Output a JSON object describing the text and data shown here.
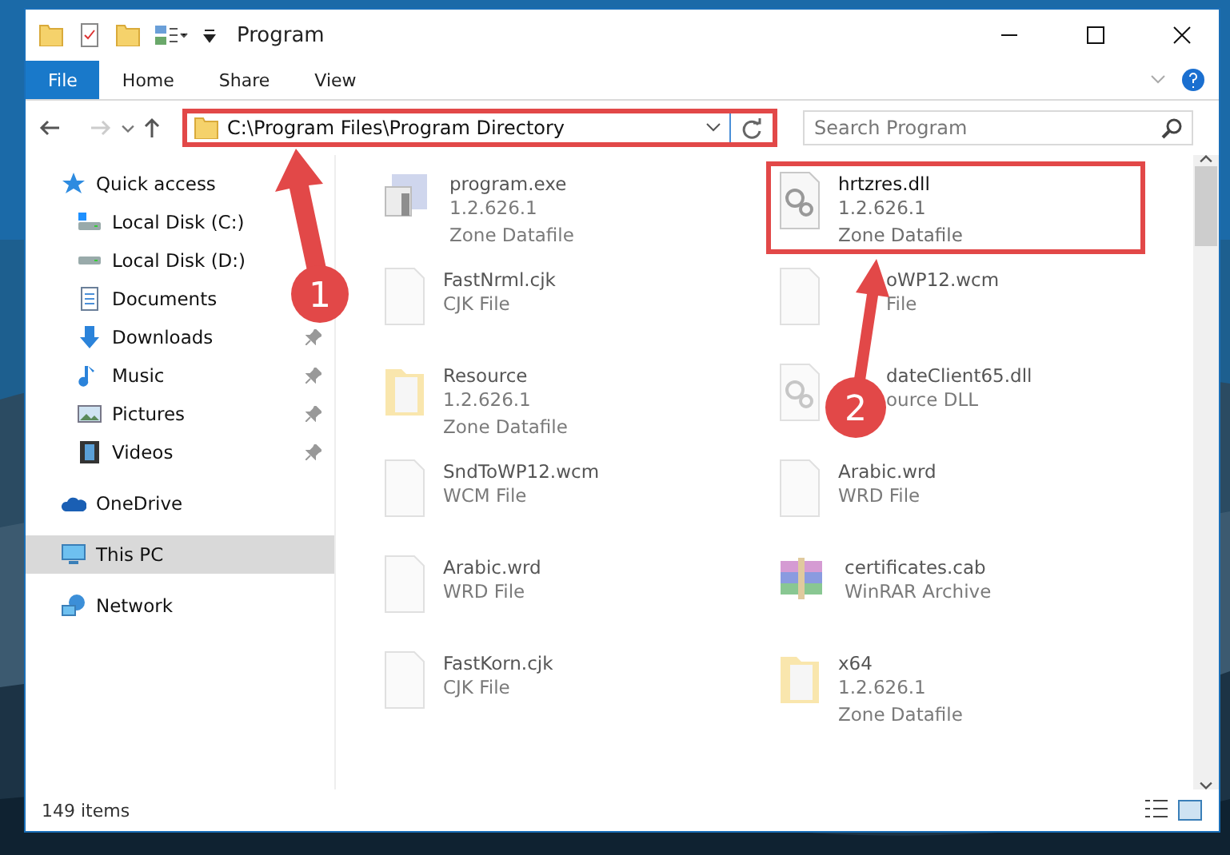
{
  "window": {
    "title": "Program"
  },
  "ribbon_tabs": [
    {
      "label": "File",
      "selected": true
    },
    {
      "label": "Home",
      "selected": false
    },
    {
      "label": "Share",
      "selected": false
    },
    {
      "label": "View",
      "selected": false
    }
  ],
  "address_bar": {
    "path": "C:\\Program Files\\Program Directory",
    "highlighted": true
  },
  "search": {
    "placeholder": "Search Program"
  },
  "sidebar": {
    "items": [
      {
        "label": "Quick access",
        "kind": "star",
        "pinned": false,
        "selected": false,
        "children": [
          {
            "label": "Local Disk (C:)",
            "kind": "disk-c",
            "pinned": false,
            "selected": false
          },
          {
            "label": "Local Disk (D:)",
            "kind": "disk",
            "pinned": false,
            "selected": false
          },
          {
            "label": "Documents",
            "kind": "documents",
            "pinned": false,
            "selected": false
          },
          {
            "label": "Downloads",
            "kind": "downloads",
            "pinned": true,
            "selected": false
          },
          {
            "label": "Music",
            "kind": "music",
            "pinned": true,
            "selected": false
          },
          {
            "label": "Pictures",
            "kind": "pictures",
            "pinned": true,
            "selected": false
          },
          {
            "label": "Videos",
            "kind": "videos",
            "pinned": true,
            "selected": false
          }
        ]
      },
      {
        "label": "OneDrive",
        "kind": "cloud",
        "pinned": false,
        "selected": false
      },
      {
        "label": "This PC",
        "kind": "pc",
        "pinned": false,
        "selected": true
      },
      {
        "label": "Network",
        "kind": "network",
        "pinned": false,
        "selected": false
      }
    ]
  },
  "files": [
    {
      "name": "program.exe",
      "lines": [
        "1.2.626.1",
        "Zone Datafile"
      ],
      "kind": "exe",
      "blurred": true,
      "highlighted": false,
      "partly_covered": false
    },
    {
      "name": "hrtzres.dll",
      "lines": [
        "1.2.626.1",
        "Zone Datafile"
      ],
      "kind": "dll",
      "blurred": false,
      "highlighted": true,
      "partly_covered": false
    },
    {
      "name": "FastNrml.cjk",
      "lines": [
        "CJK File"
      ],
      "kind": "file",
      "blurred": true,
      "highlighted": false,
      "partly_covered": false
    },
    {
      "name": "oWP12.wcm",
      "lines": [
        "File"
      ],
      "kind": "file",
      "blurred": true,
      "highlighted": false,
      "partly_covered": true
    },
    {
      "name": "Resource",
      "lines": [
        "1.2.626.1",
        "Zone Datafile"
      ],
      "kind": "folder",
      "blurred": true,
      "highlighted": false,
      "partly_covered": false
    },
    {
      "name": "dateClient65.dll",
      "lines": [
        "ource DLL"
      ],
      "kind": "dll",
      "blurred": true,
      "highlighted": false,
      "partly_covered": true
    },
    {
      "name": "SndToWP12.wcm",
      "lines": [
        "WCM File"
      ],
      "kind": "file",
      "blurred": true,
      "highlighted": false,
      "partly_covered": false
    },
    {
      "name": "Arabic.wrd",
      "lines": [
        "WRD File"
      ],
      "kind": "file",
      "blurred": true,
      "highlighted": false,
      "partly_covered": false
    },
    {
      "name": "Arabic.wrd",
      "lines": [
        "WRD File"
      ],
      "kind": "file",
      "blurred": true,
      "highlighted": false,
      "partly_covered": false
    },
    {
      "name": "certificates.cab",
      "lines": [
        "WinRAR Archive"
      ],
      "kind": "rar",
      "blurred": true,
      "highlighted": false,
      "partly_covered": false
    },
    {
      "name": "FastKorn.cjk",
      "lines": [
        "CJK File"
      ],
      "kind": "file",
      "blurred": true,
      "highlighted": false,
      "partly_covered": false
    },
    {
      "name": "x64",
      "lines": [
        "1.2.626.1",
        "Zone Datafile"
      ],
      "kind": "folder",
      "blurred": true,
      "highlighted": false,
      "partly_covered": false
    }
  ],
  "status_bar": {
    "count": "149 items"
  },
  "annotations": [
    {
      "label": "1"
    },
    {
      "label": "2"
    }
  ]
}
